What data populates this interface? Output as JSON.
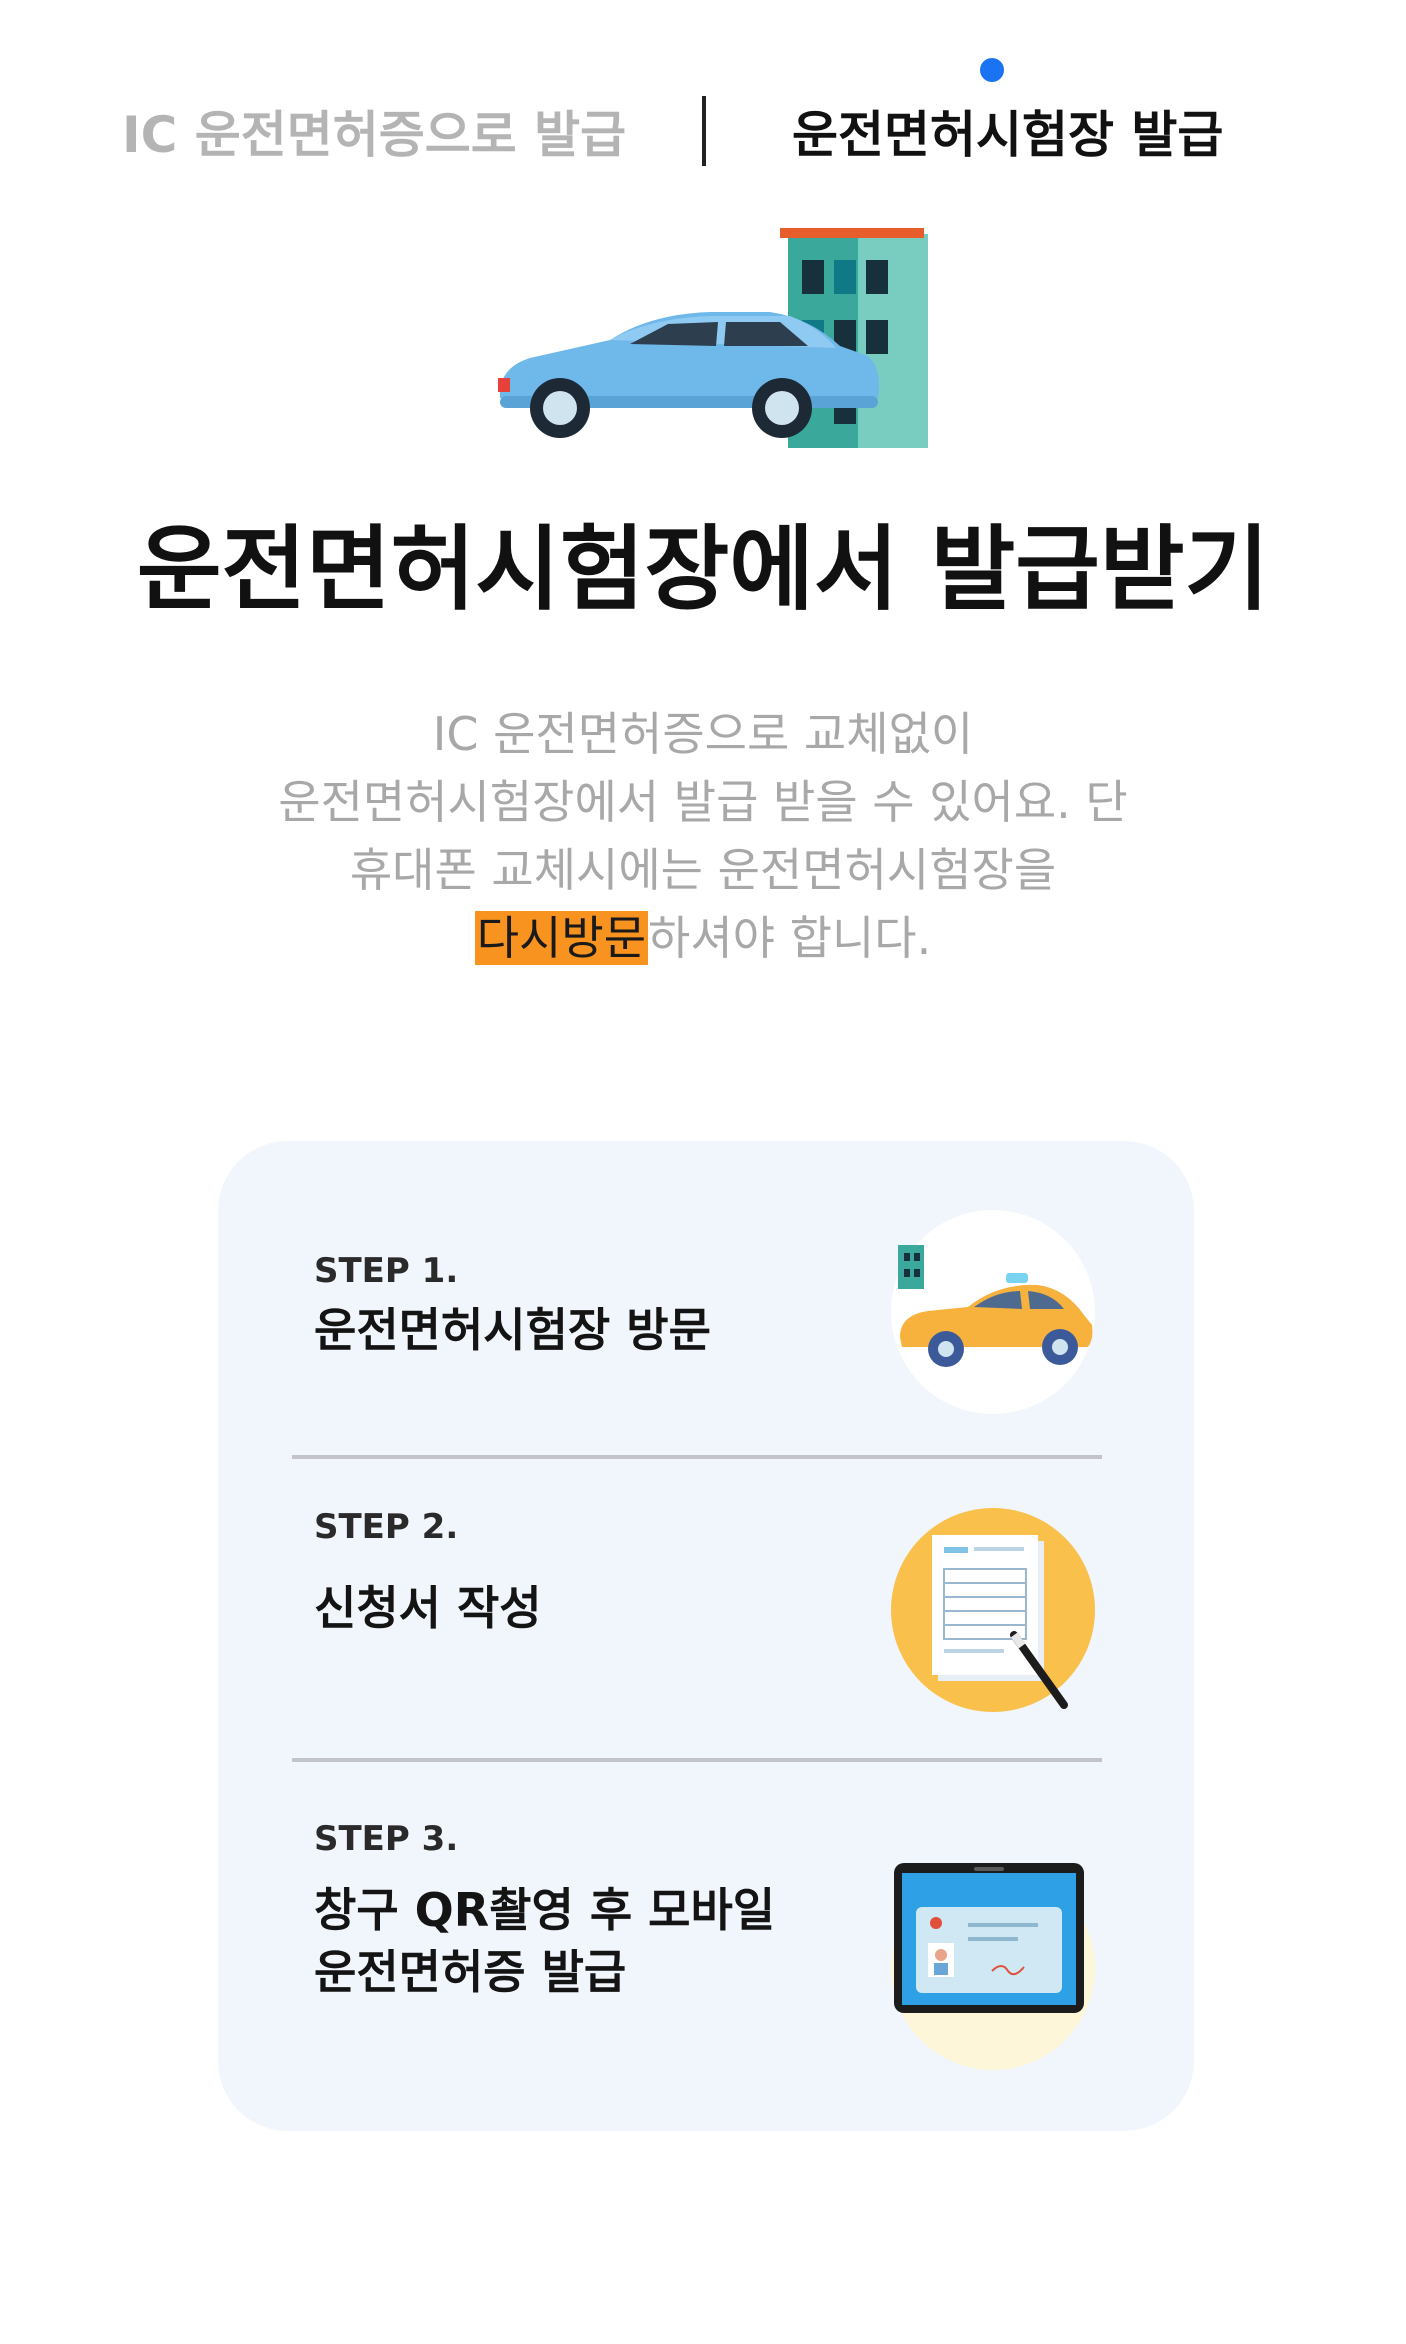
{
  "tabs": {
    "ic_label": "IC 운전면허증으로 발급",
    "exam_label": "운전면허시험장 발급"
  },
  "hero": {
    "title": "운전면허시험장에서 발급받기"
  },
  "description": {
    "line1": "IC 운전면허증으로 교체없이",
    "line2": "운전면허시험장에서 발급 받을 수 있어요. 단",
    "line3": "휴대폰 교체시에는 운전면허시험장을",
    "highlight": "다시방문",
    "line4_rest": "하셔야 합니다."
  },
  "steps": [
    {
      "label": "STEP 1.",
      "title_line1": "운전면허시험장 방문",
      "title_line2": "",
      "icon": "taxi-icon"
    },
    {
      "label": "STEP 2.",
      "title_line1": "신청서 작성",
      "title_line2": "",
      "icon": "document-pen-icon"
    },
    {
      "label": "STEP 3.",
      "title_line1": "창구 QR촬영 후 모바일",
      "title_line2": "운전면허증 발급",
      "icon": "phone-license-icon"
    }
  ],
  "colors": {
    "accent_blue": "#1a73f2",
    "highlight_orange": "#f7931e",
    "card_bg": "#f1f5fc"
  }
}
